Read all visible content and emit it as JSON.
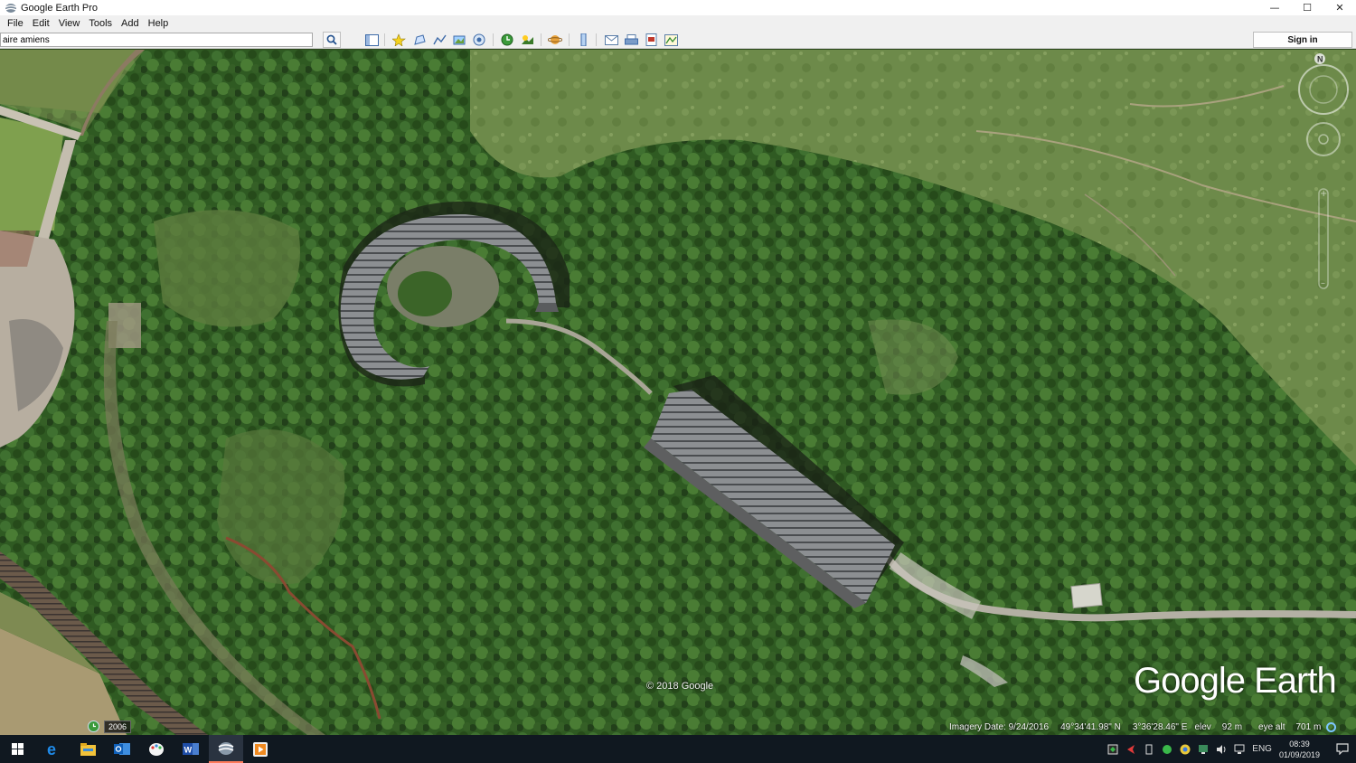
{
  "window": {
    "title": "Google Earth Pro",
    "controls": {
      "minimize": "—",
      "maximize": "☐",
      "close": "✕"
    }
  },
  "menu": {
    "items": [
      "File",
      "Edit",
      "View",
      "Tools",
      "Add",
      "Help"
    ]
  },
  "toolbar": {
    "search_value": "aire amiens",
    "sign_in_label": "Sign in",
    "buttons": [
      "sidebar-toggle-icon",
      "placemark-icon",
      "polygon-icon",
      "path-icon",
      "image-overlay-icon",
      "tour-record-icon",
      "historical-imagery-icon",
      "sun-icon",
      "planets-icon",
      "ruler-icon",
      "email-icon",
      "print-icon",
      "save-image-icon",
      "view-in-maps-icon"
    ]
  },
  "map": {
    "copyright": "© 2018 Google",
    "watermark": "Google Earth",
    "compass_letter": "N",
    "historical_year": "2006",
    "status": {
      "imagery_date": "Imagery Date: 9/24/2016",
      "latitude": "49°34'41.98\" N",
      "longitude": "3°36'28.46\" E",
      "elev_label": "elev",
      "elev_value": "92 m",
      "eye_alt_label": "eye alt",
      "eye_alt_value": "701 m"
    }
  },
  "taskbar": {
    "apps": [
      "windows-start-icon",
      "edge-icon",
      "file-explorer-icon",
      "outlook-icon",
      "paint-icon",
      "word-icon",
      "google-earth-icon",
      "media-player-icon"
    ],
    "language": "ENG",
    "time": "08:39",
    "date": "01/09/2019"
  }
}
